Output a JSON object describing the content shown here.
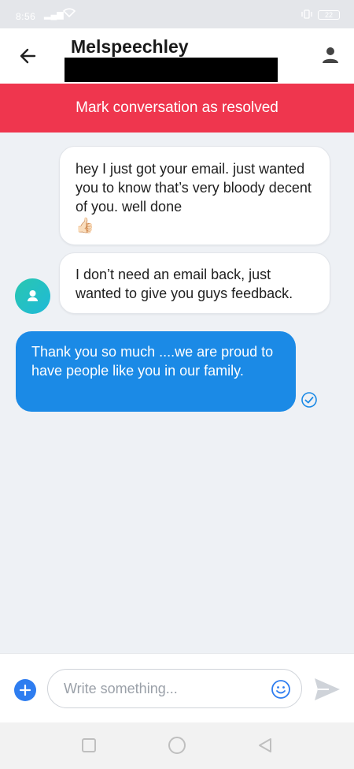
{
  "status_bar": {
    "time": "8:56",
    "battery": "22"
  },
  "header": {
    "contact_name": "Melspeechley"
  },
  "banner": {
    "label": "Mark conversation as resolved"
  },
  "messages": [
    {
      "direction": "incoming",
      "text": "hey I just got your email. just wanted you to know that’s very bloody decent of you. well done",
      "emoji": "👍🏻"
    },
    {
      "direction": "incoming",
      "text": "I don’t need an email back, just wanted to give you guys feedback."
    },
    {
      "direction": "outgoing",
      "text": "Thank you so much ....we are proud to have people like you in our family.",
      "status": "read"
    }
  ],
  "composer": {
    "placeholder": "Write something..."
  },
  "icons": {
    "back": "arrow-left-icon",
    "profile": "person-icon",
    "avatar": "person-icon",
    "read": "check-circle-icon",
    "add": "plus-icon",
    "emoji": "smiley-icon",
    "send": "send-icon"
  },
  "colors": {
    "banner": "#ef364e",
    "outgoing_bubble": "#1b8ae6",
    "add_button": "#2e7df0",
    "avatar": "#29c7b0"
  }
}
